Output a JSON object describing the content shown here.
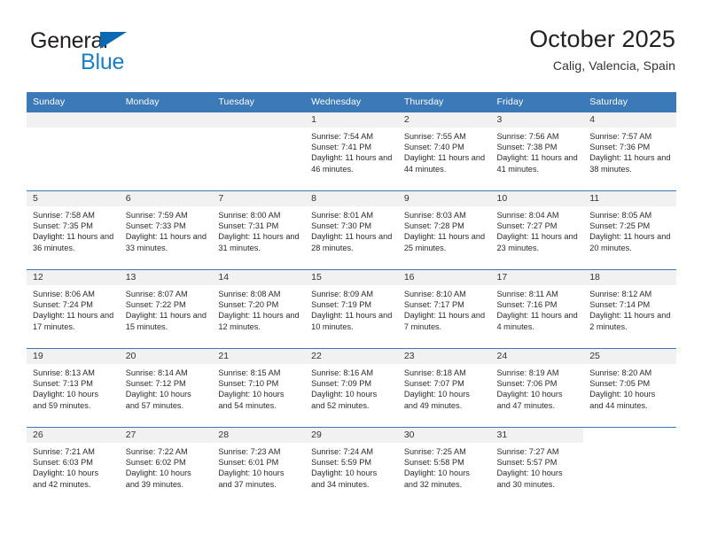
{
  "brand": {
    "name_part1": "General",
    "name_part2": "Blue",
    "triangle_color": "#0a69b4",
    "blue_color": "#1a7ec8"
  },
  "header": {
    "title": "October 2025",
    "subtitle": "Calig, Valencia, Spain"
  },
  "theme": {
    "header_blue": "#3b79b8",
    "daynum_band": "#f1f1f1",
    "text": "#2b2b2b"
  },
  "weekdays": [
    "Sunday",
    "Monday",
    "Tuesday",
    "Wednesday",
    "Thursday",
    "Friday",
    "Saturday"
  ],
  "weeks": [
    [
      {
        "day": "",
        "sunrise": "",
        "sunset": "",
        "daylight": ""
      },
      {
        "day": "",
        "sunrise": "",
        "sunset": "",
        "daylight": ""
      },
      {
        "day": "",
        "sunrise": "",
        "sunset": "",
        "daylight": ""
      },
      {
        "day": "1",
        "sunrise": "Sunrise: 7:54 AM",
        "sunset": "Sunset: 7:41 PM",
        "daylight": "Daylight: 11 hours and 46 minutes."
      },
      {
        "day": "2",
        "sunrise": "Sunrise: 7:55 AM",
        "sunset": "Sunset: 7:40 PM",
        "daylight": "Daylight: 11 hours and 44 minutes."
      },
      {
        "day": "3",
        "sunrise": "Sunrise: 7:56 AM",
        "sunset": "Sunset: 7:38 PM",
        "daylight": "Daylight: 11 hours and 41 minutes."
      },
      {
        "day": "4",
        "sunrise": "Sunrise: 7:57 AM",
        "sunset": "Sunset: 7:36 PM",
        "daylight": "Daylight: 11 hours and 38 minutes."
      }
    ],
    [
      {
        "day": "5",
        "sunrise": "Sunrise: 7:58 AM",
        "sunset": "Sunset: 7:35 PM",
        "daylight": "Daylight: 11 hours and 36 minutes."
      },
      {
        "day": "6",
        "sunrise": "Sunrise: 7:59 AM",
        "sunset": "Sunset: 7:33 PM",
        "daylight": "Daylight: 11 hours and 33 minutes."
      },
      {
        "day": "7",
        "sunrise": "Sunrise: 8:00 AM",
        "sunset": "Sunset: 7:31 PM",
        "daylight": "Daylight: 11 hours and 31 minutes."
      },
      {
        "day": "8",
        "sunrise": "Sunrise: 8:01 AM",
        "sunset": "Sunset: 7:30 PM",
        "daylight": "Daylight: 11 hours and 28 minutes."
      },
      {
        "day": "9",
        "sunrise": "Sunrise: 8:03 AM",
        "sunset": "Sunset: 7:28 PM",
        "daylight": "Daylight: 11 hours and 25 minutes."
      },
      {
        "day": "10",
        "sunrise": "Sunrise: 8:04 AM",
        "sunset": "Sunset: 7:27 PM",
        "daylight": "Daylight: 11 hours and 23 minutes."
      },
      {
        "day": "11",
        "sunrise": "Sunrise: 8:05 AM",
        "sunset": "Sunset: 7:25 PM",
        "daylight": "Daylight: 11 hours and 20 minutes."
      }
    ],
    [
      {
        "day": "12",
        "sunrise": "Sunrise: 8:06 AM",
        "sunset": "Sunset: 7:24 PM",
        "daylight": "Daylight: 11 hours and 17 minutes."
      },
      {
        "day": "13",
        "sunrise": "Sunrise: 8:07 AM",
        "sunset": "Sunset: 7:22 PM",
        "daylight": "Daylight: 11 hours and 15 minutes."
      },
      {
        "day": "14",
        "sunrise": "Sunrise: 8:08 AM",
        "sunset": "Sunset: 7:20 PM",
        "daylight": "Daylight: 11 hours and 12 minutes."
      },
      {
        "day": "15",
        "sunrise": "Sunrise: 8:09 AM",
        "sunset": "Sunset: 7:19 PM",
        "daylight": "Daylight: 11 hours and 10 minutes."
      },
      {
        "day": "16",
        "sunrise": "Sunrise: 8:10 AM",
        "sunset": "Sunset: 7:17 PM",
        "daylight": "Daylight: 11 hours and 7 minutes."
      },
      {
        "day": "17",
        "sunrise": "Sunrise: 8:11 AM",
        "sunset": "Sunset: 7:16 PM",
        "daylight": "Daylight: 11 hours and 4 minutes."
      },
      {
        "day": "18",
        "sunrise": "Sunrise: 8:12 AM",
        "sunset": "Sunset: 7:14 PM",
        "daylight": "Daylight: 11 hours and 2 minutes."
      }
    ],
    [
      {
        "day": "19",
        "sunrise": "Sunrise: 8:13 AM",
        "sunset": "Sunset: 7:13 PM",
        "daylight": "Daylight: 10 hours and 59 minutes."
      },
      {
        "day": "20",
        "sunrise": "Sunrise: 8:14 AM",
        "sunset": "Sunset: 7:12 PM",
        "daylight": "Daylight: 10 hours and 57 minutes."
      },
      {
        "day": "21",
        "sunrise": "Sunrise: 8:15 AM",
        "sunset": "Sunset: 7:10 PM",
        "daylight": "Daylight: 10 hours and 54 minutes."
      },
      {
        "day": "22",
        "sunrise": "Sunrise: 8:16 AM",
        "sunset": "Sunset: 7:09 PM",
        "daylight": "Daylight: 10 hours and 52 minutes."
      },
      {
        "day": "23",
        "sunrise": "Sunrise: 8:18 AM",
        "sunset": "Sunset: 7:07 PM",
        "daylight": "Daylight: 10 hours and 49 minutes."
      },
      {
        "day": "24",
        "sunrise": "Sunrise: 8:19 AM",
        "sunset": "Sunset: 7:06 PM",
        "daylight": "Daylight: 10 hours and 47 minutes."
      },
      {
        "day": "25",
        "sunrise": "Sunrise: 8:20 AM",
        "sunset": "Sunset: 7:05 PM",
        "daylight": "Daylight: 10 hours and 44 minutes."
      }
    ],
    [
      {
        "day": "26",
        "sunrise": "Sunrise: 7:21 AM",
        "sunset": "Sunset: 6:03 PM",
        "daylight": "Daylight: 10 hours and 42 minutes."
      },
      {
        "day": "27",
        "sunrise": "Sunrise: 7:22 AM",
        "sunset": "Sunset: 6:02 PM",
        "daylight": "Daylight: 10 hours and 39 minutes."
      },
      {
        "day": "28",
        "sunrise": "Sunrise: 7:23 AM",
        "sunset": "Sunset: 6:01 PM",
        "daylight": "Daylight: 10 hours and 37 minutes."
      },
      {
        "day": "29",
        "sunrise": "Sunrise: 7:24 AM",
        "sunset": "Sunset: 5:59 PM",
        "daylight": "Daylight: 10 hours and 34 minutes."
      },
      {
        "day": "30",
        "sunrise": "Sunrise: 7:25 AM",
        "sunset": "Sunset: 5:58 PM",
        "daylight": "Daylight: 10 hours and 32 minutes."
      },
      {
        "day": "31",
        "sunrise": "Sunrise: 7:27 AM",
        "sunset": "Sunset: 5:57 PM",
        "daylight": "Daylight: 10 hours and 30 minutes."
      },
      {
        "day": "",
        "sunrise": "",
        "sunset": "",
        "daylight": ""
      }
    ]
  ]
}
